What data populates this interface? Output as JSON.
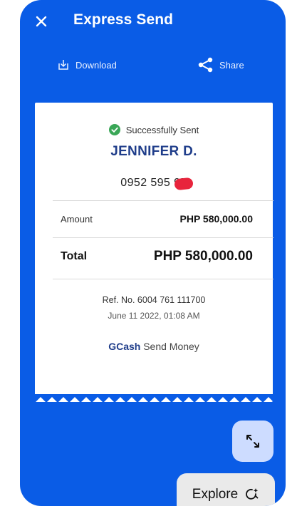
{
  "header": {
    "title": "Express Send"
  },
  "actions": {
    "download_label": "Download",
    "share_label": "Share"
  },
  "receipt": {
    "status_text": "Successfully Sent",
    "recipient_name": "JENNIFER D.",
    "recipient_number": "0952 595 95",
    "amount_label": "Amount",
    "amount_value": "PHP 580,000.00",
    "total_label": "Total",
    "total_value": "PHP 580,000.00",
    "reference": "Ref. No. 6004 761 111700",
    "date": "June 11 2022, 01:08 AM",
    "brand_name": "GCash",
    "brand_service": "Send Money"
  },
  "overlay": {
    "explore_label": "Explore"
  },
  "colors": {
    "primary_blue": "#0a5ce6",
    "success_green": "#3aa757",
    "brand_navy": "#1f3d8a"
  },
  "icons": {
    "close": "close-icon",
    "download": "download-icon",
    "share": "share-icon",
    "success": "check-circle-icon",
    "expand": "expand-icon",
    "explore": "explore-sparkle-icon"
  }
}
